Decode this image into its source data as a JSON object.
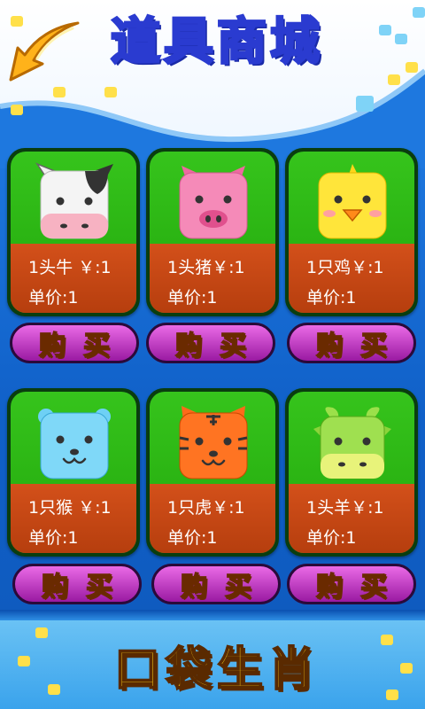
{
  "header": {
    "title": "道具商城",
    "back_icon": "arrow-left-icon"
  },
  "colors": {
    "title_fill": "#ff2fa0",
    "card_green": "#22a80c",
    "card_orange": "#c4470f",
    "buy_button": "#c23ac4",
    "buy_label": "#ffe21a"
  },
  "items": [
    {
      "animal": "cow-icon",
      "name_line": "1头牛 ￥:1",
      "price_line": "单价:1",
      "buy_label": "购买"
    },
    {
      "animal": "pig-icon",
      "name_line": "1头猪￥:1",
      "price_line": "单价:1",
      "buy_label": "购买"
    },
    {
      "animal": "chick-icon",
      "name_line": "1只鸡￥:1",
      "price_line": "单价:1",
      "buy_label": "购买"
    },
    {
      "animal": "monkey-icon",
      "name_line": "1只猴 ￥:1",
      "price_line": "单价:1",
      "buy_label": "购买"
    },
    {
      "animal": "tiger-icon",
      "name_line": "1只虎￥:1",
      "price_line": "单价:1",
      "buy_label": "购买"
    },
    {
      "animal": "goat-icon",
      "name_line": "1头羊￥:1",
      "price_line": "单价:1",
      "buy_label": "购买"
    }
  ],
  "footer": {
    "logo_text": "口袋生肖"
  }
}
